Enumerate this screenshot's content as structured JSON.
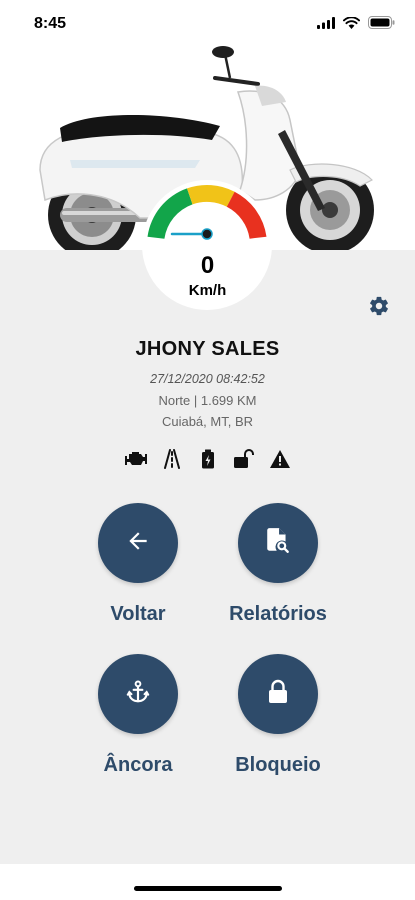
{
  "status_bar": {
    "time": "8:45"
  },
  "speed": {
    "value": "0",
    "unit": "Km/h"
  },
  "vehicle": {
    "name": "JHONY SALES",
    "timestamp": "27/12/2020 08:42:52",
    "direction_odometer": "Norte | 1.699 KM",
    "location": "Cuiabá, MT, BR"
  },
  "status_icons": [
    "engine-icon",
    "road-icon",
    "battery-icon",
    "unlocked-padlock-icon",
    "alert-triangle-icon"
  ],
  "actions": [
    {
      "label": "Voltar",
      "icon": "arrow-left-icon"
    },
    {
      "label": "Relatórios",
      "icon": "report-search-icon"
    },
    {
      "label": "Âncora",
      "icon": "anchor-icon"
    },
    {
      "label": "Bloqueio",
      "icon": "lock-icon"
    }
  ],
  "colors": {
    "accent": "#2e4b6a",
    "panel_bg": "#efefef",
    "gauge_green": "#12a54a",
    "gauge_yellow": "#f1c318",
    "gauge_red": "#e8311f"
  }
}
